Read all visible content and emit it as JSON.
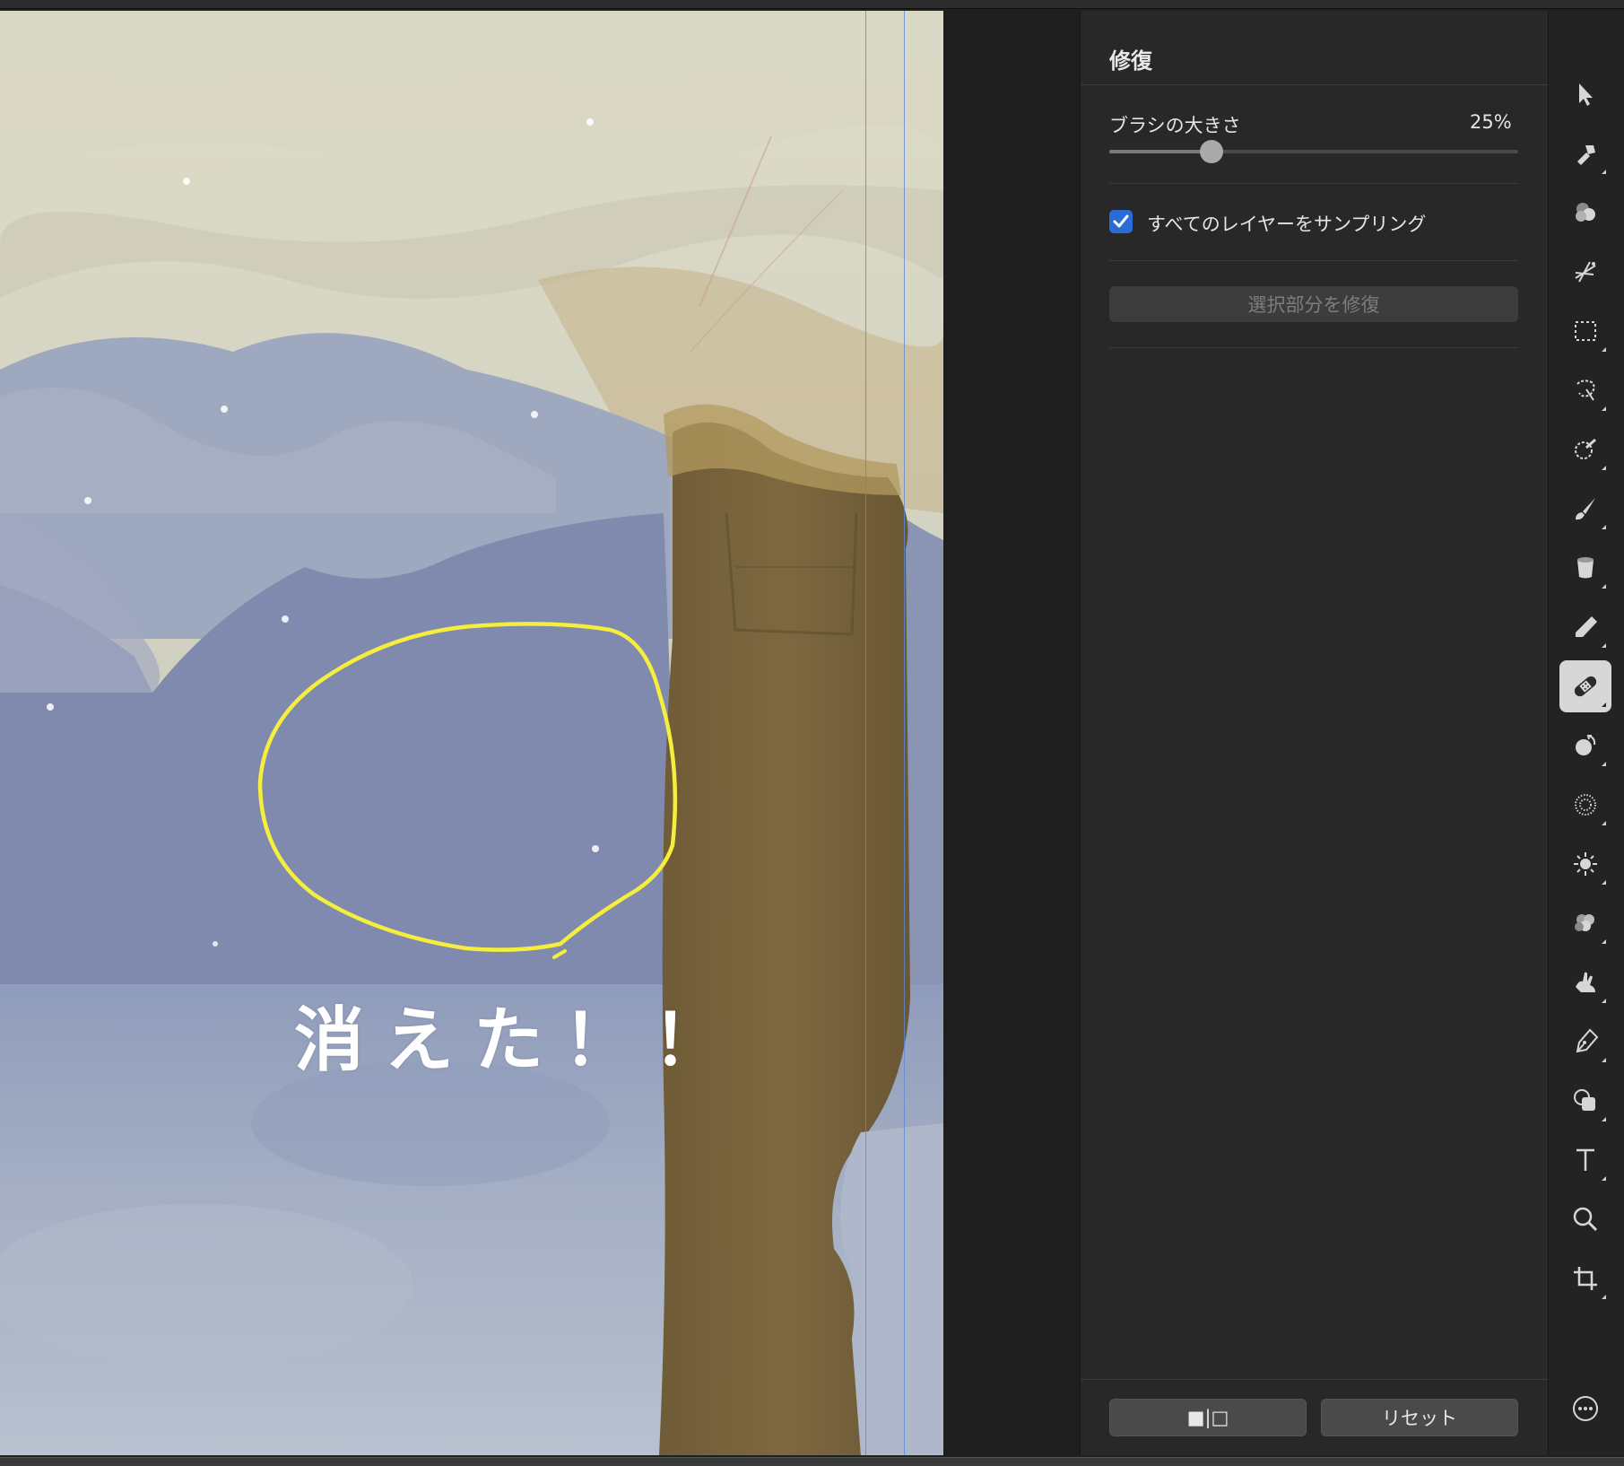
{
  "canvas": {
    "caption": "消えた！！",
    "annotation_color": "#f5ee3c"
  },
  "panel": {
    "title": "修復",
    "brush_size_label": "ブラシの大きさ",
    "brush_size_value": "25%",
    "brush_size_fraction": 0.25,
    "sample_all_layers_label": "すべてのレイヤーをサンプリング",
    "sample_all_layers_checked": true,
    "repair_selection_button": "選択部分を修復",
    "compare_button": "■|□",
    "reset_button": "リセット"
  },
  "colors": {
    "checkbox_accent": "#2a6bd6",
    "panel_bg": "#282828",
    "guide_line": "#5b88d8"
  },
  "toolbar": {
    "tools": [
      {
        "name": "select-arrow-icon",
        "active": false
      },
      {
        "name": "paint-brush-hammer-icon",
        "active": false
      },
      {
        "name": "color-blend-icon",
        "active": false
      },
      {
        "name": "sparkle-selection-icon",
        "active": false
      },
      {
        "name": "marquee-select-icon",
        "active": false
      },
      {
        "name": "lasso-select-icon",
        "active": false
      },
      {
        "name": "magic-select-icon",
        "active": false
      },
      {
        "name": "paint-brush-icon",
        "active": false
      },
      {
        "name": "paint-bucket-icon",
        "active": false
      },
      {
        "name": "eraser-icon",
        "active": false
      },
      {
        "name": "healing-bandage-icon",
        "active": true
      },
      {
        "name": "clone-stamp-icon",
        "active": false
      },
      {
        "name": "blur-icon",
        "active": false
      },
      {
        "name": "dodge-burn-icon",
        "active": false
      },
      {
        "name": "color-adjust-icon",
        "active": false
      },
      {
        "name": "smudge-icon",
        "active": false
      },
      {
        "name": "pen-tool-icon",
        "active": false
      },
      {
        "name": "shape-tool-icon",
        "active": false
      },
      {
        "name": "text-tool-icon",
        "active": false
      },
      {
        "name": "zoom-icon",
        "active": false
      },
      {
        "name": "crop-icon",
        "active": false
      },
      {
        "name": "more-options-icon",
        "active": false
      }
    ]
  }
}
